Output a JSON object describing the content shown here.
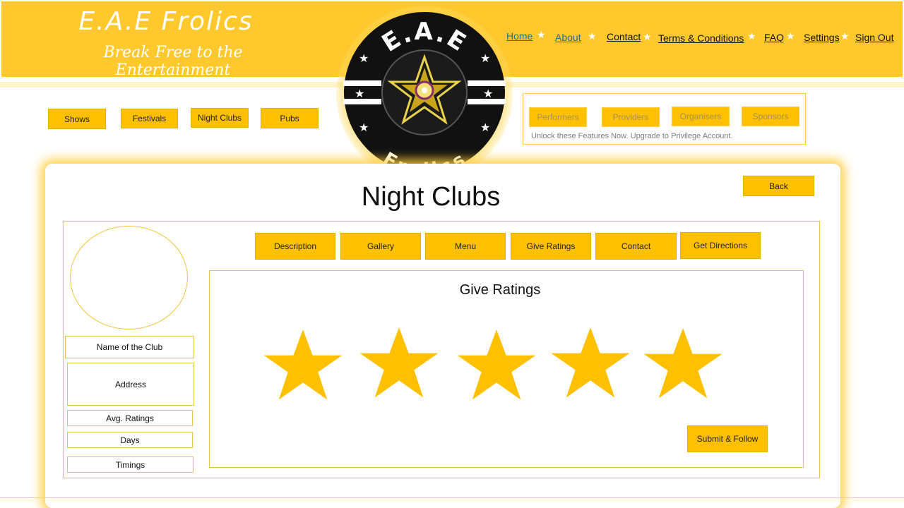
{
  "brand": {
    "title": "E.A.E Frolics",
    "tagline": "Break Free to the Entertainment",
    "logo_top": "E.A.E",
    "logo_bottom": "Frolics"
  },
  "nav": {
    "items": [
      "Home",
      "About",
      "Contact",
      "Terms & Conditions",
      "FAQ",
      "Settings",
      "Sign Out"
    ]
  },
  "categories": [
    "Shows",
    "Festivals",
    "Night Clubs",
    "Pubs"
  ],
  "premium": {
    "items": [
      "Performers",
      "Providers",
      "Organisers",
      "Sponsors"
    ],
    "note": "Unlock these Features Now. Upgrade to Privilege Account."
  },
  "page": {
    "title": "Night Clubs",
    "back_label": "Back"
  },
  "club_info": {
    "name": "Name of the Club",
    "address": "Address",
    "avg_ratings": "Avg. Ratings",
    "days": "Days",
    "timings": "Timings"
  },
  "tabs": [
    "Description",
    "Gallery",
    "Menu",
    "Give Ratings",
    "Contact",
    "Get Directions"
  ],
  "ratings": {
    "title": "Give Ratings",
    "star_count": 5,
    "submit_label": "Submit & Follow"
  },
  "colors": {
    "brand_yellow": "#ffc92e",
    "button_yellow": "#ffc000",
    "star_yellow": "#ffc000",
    "logo_black": "#111111"
  }
}
